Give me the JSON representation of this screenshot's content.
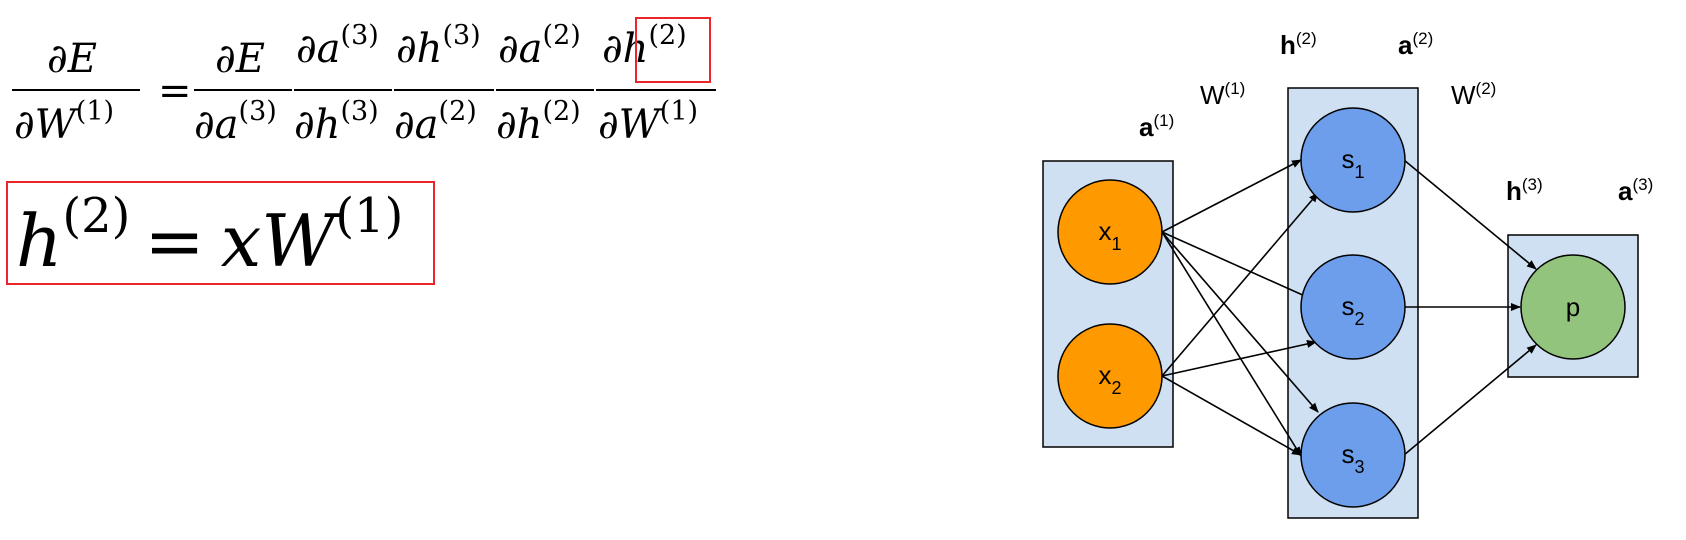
{
  "equations": {
    "chain_rule": {
      "lhs": {
        "num": "∂E",
        "den_main": "∂W",
        "den_sup": "(1)"
      },
      "eq": "=",
      "factors": [
        {
          "num_main": "∂E",
          "num_sup": "",
          "den_main": "∂a",
          "den_sup": "(3)"
        },
        {
          "num_main": "∂a",
          "num_sup": "(3)",
          "den_main": "∂h",
          "den_sup": "(3)"
        },
        {
          "num_main": "∂h",
          "num_sup": "(3)",
          "den_main": "∂a",
          "den_sup": "(2)"
        },
        {
          "num_main": "∂a",
          "num_sup": "(2)",
          "den_main": "∂h",
          "den_sup": "(2)"
        },
        {
          "num_main": "∂h",
          "num_sup": "(2)",
          "den_main": "∂W",
          "den_sup": "(1)"
        }
      ]
    },
    "forward": {
      "lhs_main": "h",
      "lhs_sup": "(2)",
      "eq": "=",
      "rhs_main": "xW",
      "rhs_sup": "(1)"
    }
  },
  "highlight_color": "#e8262c",
  "network": {
    "colors": {
      "layer_fill": "#cfe0f2",
      "input_node": "#ff9900",
      "hidden_node": "#6d9eeb",
      "output_node": "#93c47d",
      "stroke": "#000000"
    },
    "layer_labels": {
      "a1": {
        "main": "a",
        "sup": "(1)"
      },
      "W1": {
        "main": "W",
        "sup": "(1)"
      },
      "h2": {
        "main": "h",
        "sup": "(2)"
      },
      "a2": {
        "main": "a",
        "sup": "(2)"
      },
      "W2": {
        "main": "W",
        "sup": "(2)"
      },
      "h3": {
        "main": "h",
        "sup": "(3)"
      },
      "a3": {
        "main": "a",
        "sup": "(3)"
      }
    },
    "nodes": {
      "x1": {
        "main": "x",
        "sub": "1"
      },
      "x2": {
        "main": "x",
        "sub": "2"
      },
      "s1": {
        "main": "s",
        "sub": "1"
      },
      "s2": {
        "main": "s",
        "sub": "2"
      },
      "s3": {
        "main": "s",
        "sub": "3"
      },
      "p": {
        "main": "p",
        "sub": ""
      }
    }
  }
}
